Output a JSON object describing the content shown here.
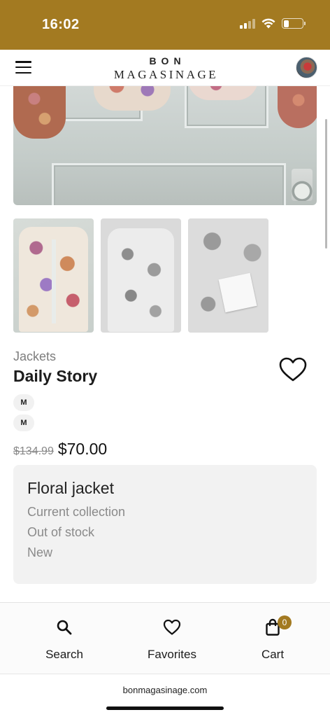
{
  "status_bar": {
    "time": "16:02",
    "background_color": "#a37a21",
    "icons": [
      "cellular-signal-icon",
      "wifi-icon",
      "battery-icon"
    ]
  },
  "header": {
    "brand_line1": "BON",
    "brand_line2": "MAGASINAGE",
    "menu_icon": "hamburger-menu-icon",
    "avatar_icon": "profile-avatar"
  },
  "gallery": {
    "thumbnails": [
      "floral jacket front",
      "floral jacket grayscale",
      "jacket tag grayscale"
    ]
  },
  "product": {
    "category": "Jackets",
    "title": "Daily Story",
    "sizes": [
      "M",
      "M"
    ],
    "old_price": "$134.99",
    "price": "$70.00",
    "favorite_icon": "heart-outline-icon"
  },
  "details": {
    "title": "Floral jacket",
    "lines": [
      "Current collection",
      "Out of stock",
      "New"
    ]
  },
  "bottom_nav": {
    "items": [
      {
        "label": "Search",
        "icon": "search-icon"
      },
      {
        "label": "Favorites",
        "icon": "heart-icon"
      },
      {
        "label": "Cart",
        "icon": "shopping-bag-icon",
        "badge": "0"
      }
    ],
    "accent_color": "#a37a21"
  },
  "browser": {
    "url": "bonmagasinage.com"
  }
}
